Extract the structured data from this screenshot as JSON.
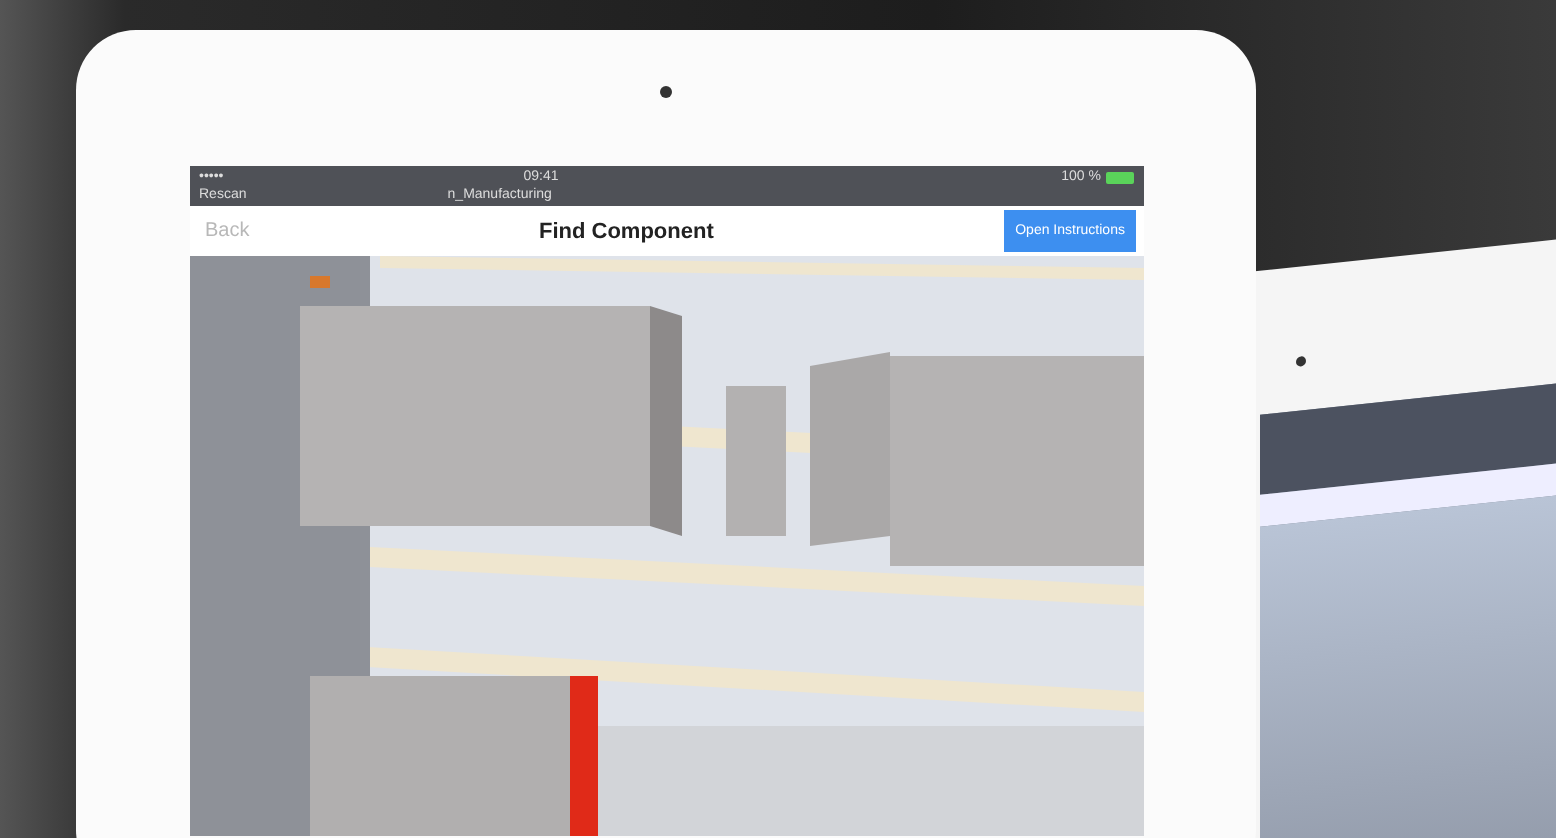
{
  "status_bar": {
    "signal": "•••••",
    "time": "09:41",
    "battery": "100 %",
    "back_app": "Rescan",
    "subtitle": "n_Manufacturing"
  },
  "nav_bar": {
    "back": {
      "label": "Back",
      "disabled": true
    },
    "title": "Find Component",
    "action": "Open Instructions"
  }
}
